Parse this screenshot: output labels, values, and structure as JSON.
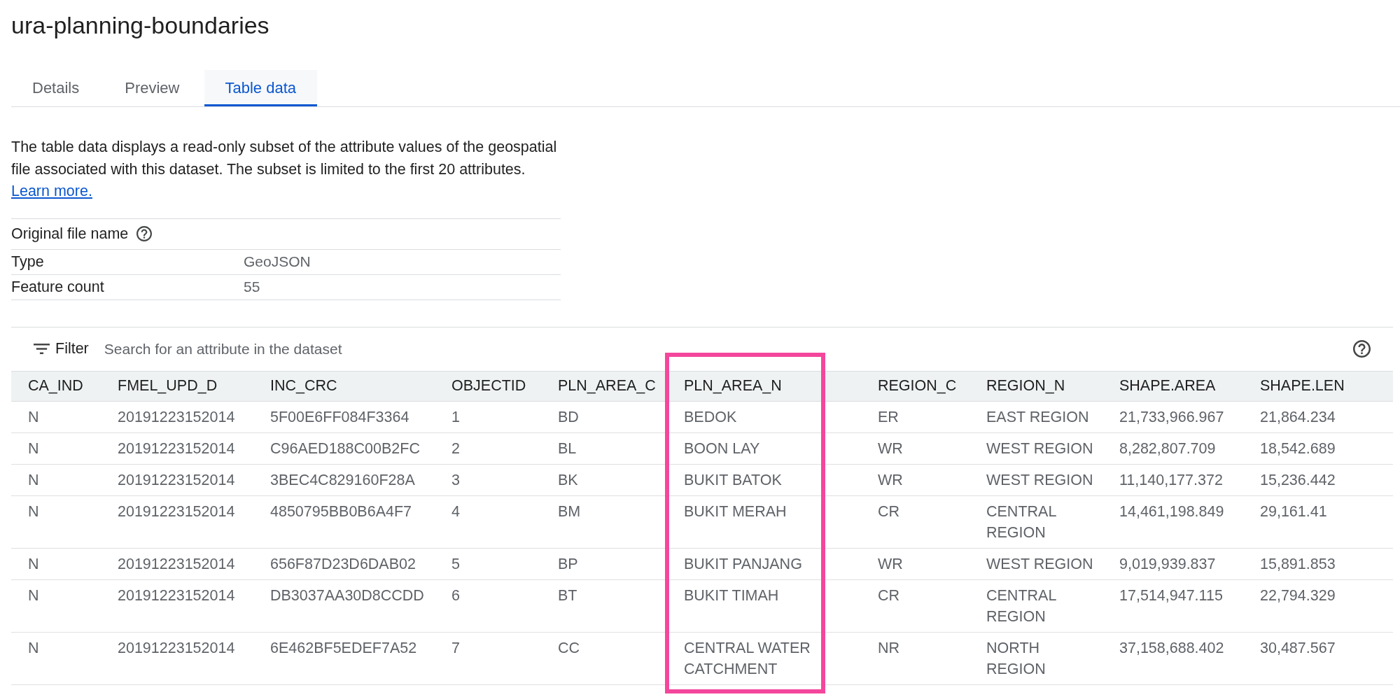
{
  "title": "ura-planning-boundaries",
  "tabs": [
    {
      "label": "Details",
      "selected": false
    },
    {
      "label": "Preview",
      "selected": false
    },
    {
      "label": "Table data",
      "selected": true
    }
  ],
  "description": "The table data displays a read-only subset of the attribute values of the geospatial file associated with this dataset. The subset is limited to the first 20 attributes.",
  "learn_more_link": "Learn more.",
  "file_info": [
    {
      "label": "Original file name",
      "help_icon": true
    },
    {
      "label": "Type",
      "value": "GeoJSON",
      "help_icon": false
    },
    {
      "label": "Feature count",
      "value": "55",
      "help_icon": false
    }
  ],
  "filter": {
    "label": "Filter",
    "placeholder": "Search for an attribute in the dataset"
  },
  "table": {
    "columns": [
      {
        "label": "CA_IND",
        "highlighted": false
      },
      {
        "label": "FMEL_UPD_D",
        "highlighted": false
      },
      {
        "label": "INC_CRC",
        "highlighted": false
      },
      {
        "label": "OBJECTID",
        "highlighted": false
      },
      {
        "label": "PLN_AREA_C",
        "highlighted": false
      },
      {
        "label": "PLN_AREA_N",
        "highlighted": true
      },
      {
        "label": "REGION_C",
        "highlighted": false
      },
      {
        "label": "REGION_N",
        "highlighted": false
      },
      {
        "label": "SHAPE.AREA",
        "highlighted": false
      },
      {
        "label": "SHAPE.LEN",
        "highlighted": false
      }
    ],
    "rows": [
      [
        "N",
        "20191223152014",
        "5F00E6FF084F3364",
        "1",
        "BD",
        "BEDOK",
        "ER",
        "EAST REGION",
        "21,733,966.967",
        "21,864.234"
      ],
      [
        "N",
        "20191223152014",
        "C96AED188C00B2FC",
        "2",
        "BL",
        "BOON LAY",
        "WR",
        "WEST REGION",
        "8,282,807.709",
        "18,542.689"
      ],
      [
        "N",
        "20191223152014",
        "3BEC4C829160F28A",
        "3",
        "BK",
        "BUKIT BATOK",
        "WR",
        "WEST REGION",
        "11,140,177.372",
        "15,236.442"
      ],
      [
        "N",
        "20191223152014",
        "4850795BB0B6A4F7",
        "4",
        "BM",
        "BUKIT MERAH",
        "CR",
        "CENTRAL REGION",
        "14,461,198.849",
        "29,161.41"
      ],
      [
        "N",
        "20191223152014",
        "656F87D23D6DAB02",
        "5",
        "BP",
        "BUKIT PANJANG",
        "WR",
        "WEST REGION",
        "9,019,939.837",
        "15,891.853"
      ],
      [
        "N",
        "20191223152014",
        "DB3037AA30D8CCDD",
        "6",
        "BT",
        "BUKIT TIMAH",
        "CR",
        "CENTRAL REGION",
        "17,514,947.115",
        "22,794.329"
      ],
      [
        "N",
        "20191223152014",
        "6E462BF5EDEF7A52",
        "7",
        "CC",
        "CENTRAL WATER CATCHMENT",
        "NR",
        "NORTH REGION",
        "37,158,688.402",
        "30,487.567"
      ]
    ]
  }
}
